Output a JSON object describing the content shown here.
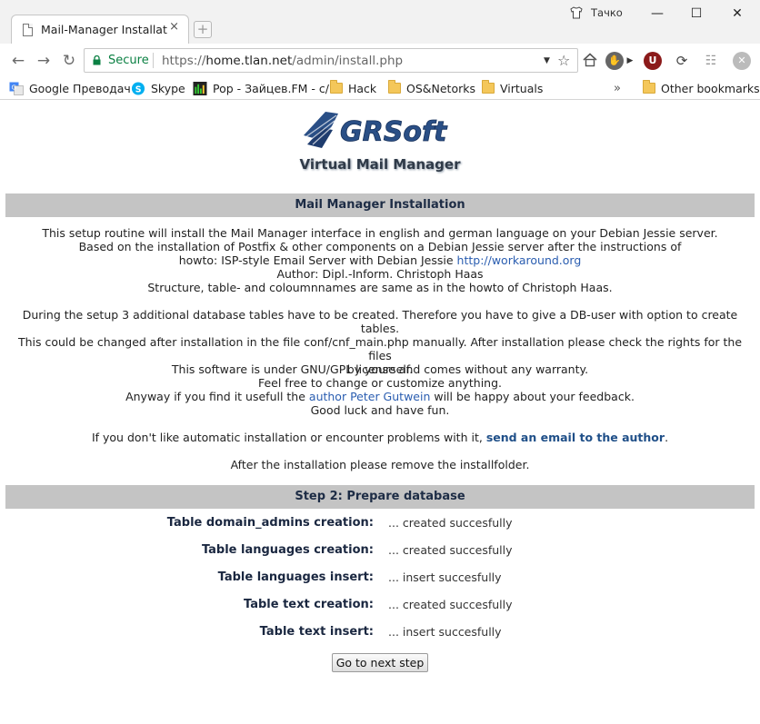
{
  "browser": {
    "tab_title": "Mail-Manager Installation",
    "tab_close": "×",
    "new_tab": "+",
    "profile_name": "Тачко",
    "window": {
      "minimize": "—",
      "maximize": "☐",
      "close": "✕"
    },
    "secure_label": "Secure",
    "url_scheme": "https://",
    "url_host": "home.tlan.net",
    "url_path": "/admin/install.php",
    "bookmarks": [
      {
        "label": "Google Преводач",
        "icon": "google-translate-icon"
      },
      {
        "label": "Skype",
        "icon": "skype-icon"
      },
      {
        "label": "Pop - Зайцев.FM - с/",
        "icon": "equalizer-icon"
      },
      {
        "label": "Hack",
        "icon": "folder-icon"
      },
      {
        "label": "OS&Netorks",
        "icon": "folder-icon"
      },
      {
        "label": "Virtuals",
        "icon": "folder-icon"
      },
      {
        "label": "Other bookmarks",
        "icon": "folder-icon"
      }
    ],
    "more_bookmarks": "»"
  },
  "page": {
    "logo_text": "GRSoft",
    "logo_subtitle": "Virtual Mail Manager",
    "install_header": "Mail Manager Installation",
    "intro": {
      "line1": "This setup routine will install the Mail Manager interface in english and german language on your Debian Jessie server.",
      "line2": "Based on the installation of Postfix & other components on a Debian Jessie server after the instructions of",
      "line3_prefix": "howto: ISP-style Email Server with Debian Jessie ",
      "line3_link": "http://workaround.org",
      "line4": "Author: Dipl.-Inform. Christoph Haas",
      "line5": "Structure, table- and coloumnnames are same as in the howto of Christoph Haas."
    },
    "setup": {
      "line1": "During the setup 3 additional database tables have to be created. Therefore you have to give a DB-user with option to create tables.",
      "line2": "This could be changed after installation in the file conf/cnf_main.php manually. After installation please check the rights for the files",
      "line3": "by yourself."
    },
    "license": {
      "line1": "This software is under GNU/GPL license and comes without any warranty.",
      "line2": "Feel free to change or customize anything.",
      "line3_prefix": "Anyway if you find it usefull the ",
      "line3_link": "author Peter Gutwein",
      "line3_suffix": " will be happy about your feedback.",
      "line4": "Good luck and have fun."
    },
    "contact": {
      "prefix": "If you don't like automatic installation or encounter problems with it, ",
      "link": "send an email to the author",
      "suffix": "."
    },
    "remove_note": "After the installation please remove the installfolder.",
    "step_header": "Step 2: Prepare database",
    "steps": [
      {
        "label": "Table domain_admins creation:",
        "status": "... created succesfully"
      },
      {
        "label": "Table languages creation:",
        "status": "... created succesfully"
      },
      {
        "label": "Table languages insert:",
        "status": "... insert succesfully"
      },
      {
        "label": "Table text creation:",
        "status": "... created succesfully"
      },
      {
        "label": "Table text insert:",
        "status": "... insert succesfully"
      }
    ],
    "next_button": "Go to next step"
  },
  "colors": {
    "header_bar": "#c4c4c4",
    "link": "#2a5db0",
    "secure_green": "#0b8043",
    "folder": "#f4c75a"
  }
}
